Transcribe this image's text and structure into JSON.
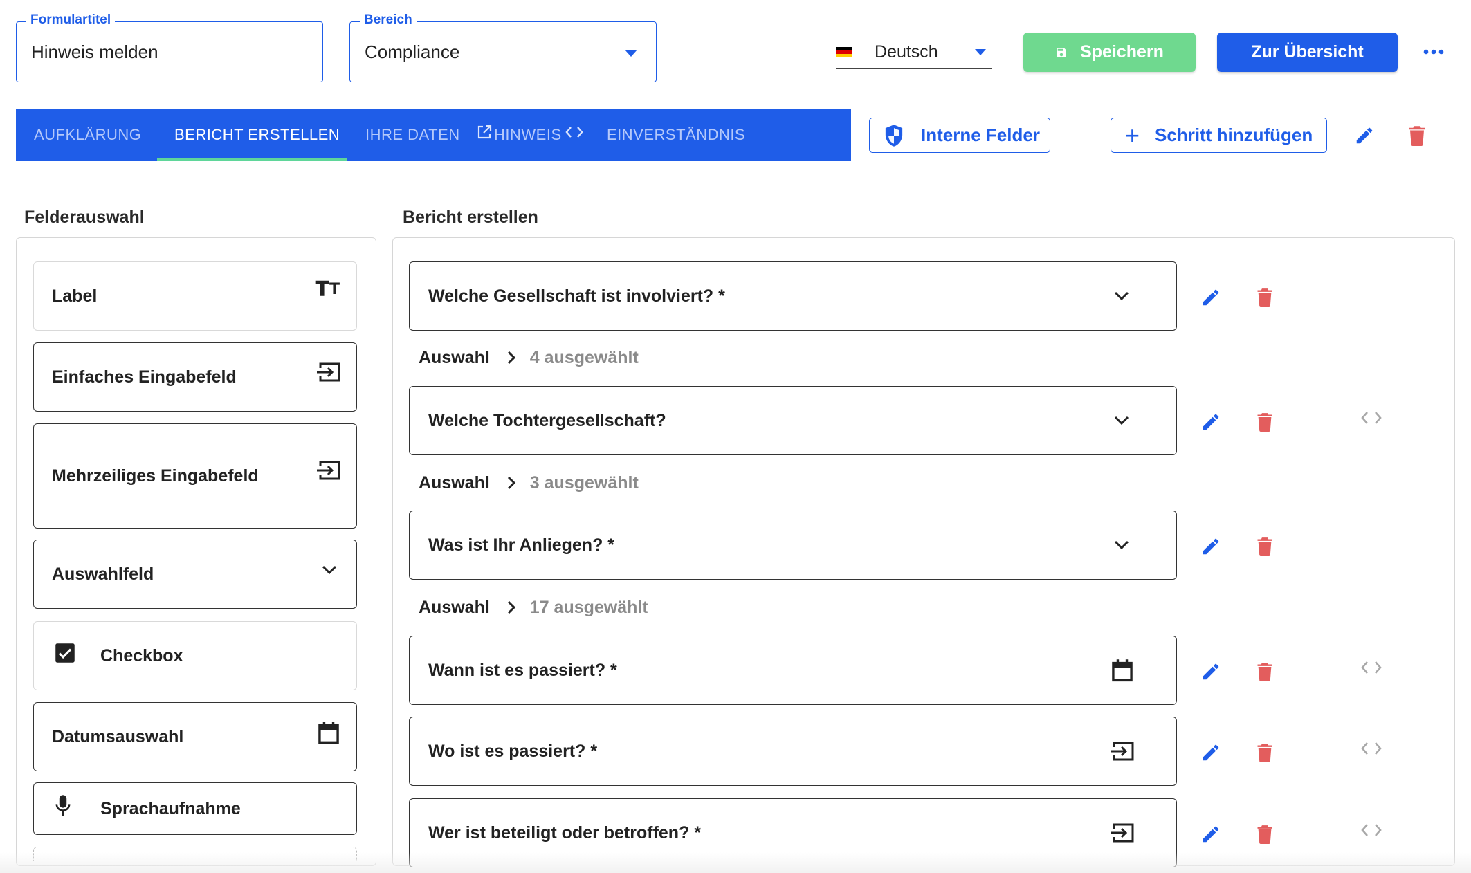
{
  "header": {
    "form_title_legend": "Formulartitel",
    "form_title_value": "Hinweis melden",
    "area_legend": "Bereich",
    "area_value": "Compliance",
    "language": "Deutsch",
    "save_label": "Speichern",
    "overview_label": "Zur Übersicht",
    "more_icon": "more-horizontal-icon"
  },
  "steps": {
    "tabs": [
      {
        "label": "AUFKLÄRUNG",
        "active": false
      },
      {
        "label": "BERICHT ERSTELLEN",
        "active": true
      },
      {
        "label": "IHRE DATEN",
        "active": false
      },
      {
        "label": "HINWEIS",
        "active": false
      },
      {
        "label": "EINVERSTÄNDNIS",
        "active": false
      }
    ],
    "internal_fields_label": "Interne Felder",
    "add_step_label": "Schritt hinzufügen"
  },
  "palette": {
    "title": "Felderauswahl",
    "items": [
      {
        "label": "Label",
        "icon": "text-size-icon"
      },
      {
        "label": "Einfaches Eingabefeld",
        "icon": "input-icon"
      },
      {
        "label": "Mehrzeiliges Eingabefeld",
        "icon": "input-icon"
      },
      {
        "label": "Auswahlfeld",
        "icon": "chevron-down-icon"
      },
      {
        "label": "Checkbox",
        "icon": "checkbox-checked-icon"
      },
      {
        "label": "Datumsauswahl",
        "icon": "calendar-icon"
      },
      {
        "label": "Sprachaufnahme",
        "icon": "microphone-icon"
      }
    ]
  },
  "report": {
    "title": "Bericht erstellen",
    "questions": [
      {
        "text": "Welche Gesellschaft ist involviert? *",
        "icon": "chevron-down-icon"
      },
      {
        "text": "Welche Tochtergesellschaft?",
        "icon": "chevron-down-icon"
      },
      {
        "text": "Was ist Ihr Anliegen? *",
        "icon": "chevron-down-icon"
      },
      {
        "text": "Wann ist es passiert? *",
        "icon": "calendar-icon"
      },
      {
        "text": "Wo ist es passiert? *",
        "icon": "input-icon"
      },
      {
        "text": "Wer ist beteiligt oder betroffen? *",
        "icon": "input-icon"
      }
    ],
    "selections": [
      {
        "label": "Auswahl",
        "count": "4 ausgewählt"
      },
      {
        "label": "Auswahl",
        "count": "3 ausgewählt"
      },
      {
        "label": "Auswahl",
        "count": "17 ausgewählt"
      }
    ]
  },
  "colors": {
    "primary": "#1f5de8",
    "save_green": "#6fd98f",
    "delete_red": "#e35d5d",
    "tab_active_underline": "#5fd69a"
  }
}
